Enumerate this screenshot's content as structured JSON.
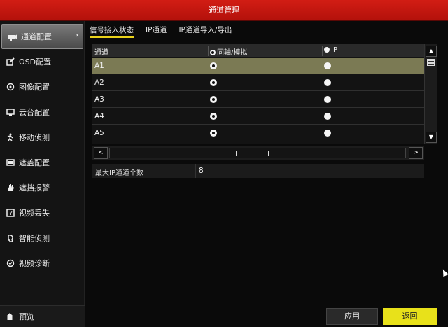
{
  "window": {
    "title": "通道管理"
  },
  "sidebar": {
    "items": [
      {
        "label": "通道配置",
        "icon": "camera-icon",
        "active": true
      },
      {
        "label": "OSD配置",
        "icon": "osd-edit-icon"
      },
      {
        "label": "图像配置",
        "icon": "image-settings-icon"
      },
      {
        "label": "云台配置",
        "icon": "ptz-icon"
      },
      {
        "label": "移动侦测",
        "icon": "motion-person-icon"
      },
      {
        "label": "遮盖配置",
        "icon": "privacy-mask-icon"
      },
      {
        "label": "遮挡报警",
        "icon": "tamper-hand-icon"
      },
      {
        "label": "视频丢失",
        "icon": "video-loss-icon"
      },
      {
        "label": "智能侦测",
        "icon": "smart-detection-icon"
      },
      {
        "label": "视频诊断",
        "icon": "video-diagnosis-icon"
      }
    ],
    "active_arrow": "›",
    "bottom": {
      "label": "预览",
      "icon": "home-icon"
    }
  },
  "tabs": [
    {
      "label": "信号接入状态",
      "active": true
    },
    {
      "label": "IP通道"
    },
    {
      "label": "IP通道导入/导出"
    }
  ],
  "table": {
    "headers": {
      "channel": "通道",
      "analog": "同轴/模拟",
      "ip": "IP"
    },
    "rows": [
      {
        "name": "A1",
        "analog": true,
        "ip": false,
        "selected": true
      },
      {
        "name": "A2",
        "analog": true,
        "ip": false
      },
      {
        "name": "A3",
        "analog": true,
        "ip": false
      },
      {
        "name": "A4",
        "analog": true,
        "ip": false
      },
      {
        "name": "A5",
        "analog": true,
        "ip": false
      }
    ]
  },
  "scroll": {
    "up": "▲",
    "down": "▼",
    "left": "<",
    "right": ">"
  },
  "info": {
    "label": "最大IP通道个数",
    "value": "8"
  },
  "buttons": {
    "apply": "应用",
    "back": "返回"
  },
  "colors": {
    "title_bar": "#c8170f",
    "active_tab_underline": "#e9d21a",
    "selected_row": "#7b7a54",
    "back_button": "#e8e11a"
  }
}
